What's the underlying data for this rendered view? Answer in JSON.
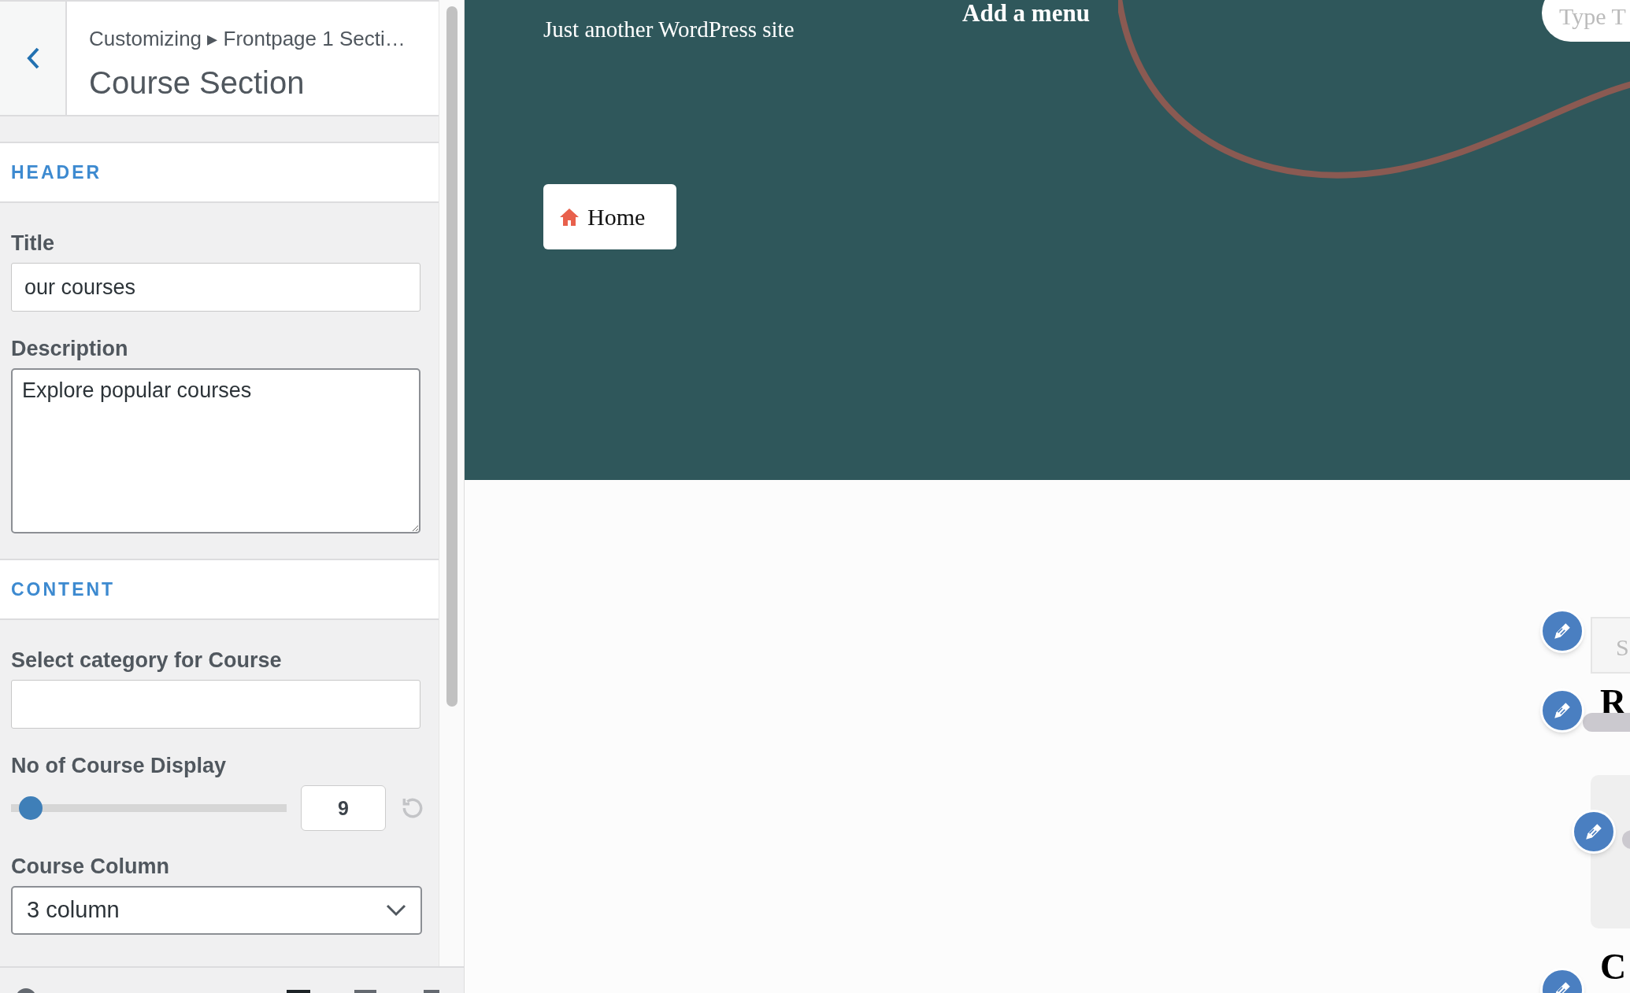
{
  "panel": {
    "breadcrumb": "Customizing ▸ Frontpage 1 Secti…",
    "title": "Course Section"
  },
  "sections": [
    {
      "heading": "HEADER",
      "fields": [
        {
          "kind": "text",
          "label": "Title",
          "value": "our courses"
        },
        {
          "kind": "textarea",
          "label": "Description",
          "value": "Explore popular courses"
        }
      ]
    },
    {
      "heading": "CONTENT",
      "fields": [
        {
          "kind": "text",
          "label": "Select category for Course"
        },
        {
          "kind": "range",
          "label": "No of Course Display",
          "level": 0.03,
          "value": "9"
        },
        {
          "kind": "select",
          "label": "Course Column",
          "value": "3 column"
        }
      ]
    }
  ],
  "preview": {
    "tagline": "Just another WordPress site",
    "menu": "Add a menu",
    "search_placeholder": "Type T",
    "home_button": "Home",
    "partial_texts": [
      {
        "kind": "search",
        "text": "S"
      },
      {
        "kind": "heading",
        "text": "R"
      },
      {
        "kind": "heading",
        "text": "C"
      }
    ]
  }
}
